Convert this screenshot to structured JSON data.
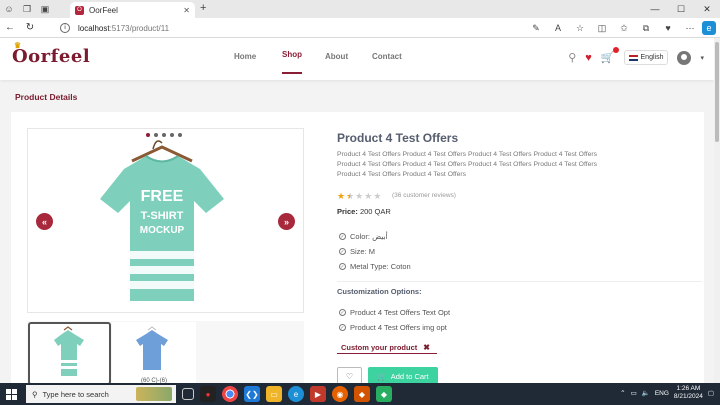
{
  "browser": {
    "tab_title": "OorFeel",
    "url_host": "localhost",
    "url_path": ":5173/product/11"
  },
  "site": {
    "logo": "Oorfeel",
    "menu": {
      "home": "Home",
      "shop": "Shop",
      "about": "About",
      "contact": "Contact"
    },
    "language": "English",
    "accent_color": "#8b1e36"
  },
  "page": {
    "title": "Product Details"
  },
  "product": {
    "name": "Product 4 Test Offers",
    "description": "Product 4 Test Offers Product 4 Test Offers Product 4 Test Offers Product 4 Test Offers Product 4 Test Offers Product 4 Test Offers Product 4 Test Offers Product 4 Test Offers Product 4 Test Offers Product 4 Test Offers",
    "rating": 1.5,
    "rating_max": 5,
    "reviews": "(36 customer reviews)",
    "price_label": "Price:",
    "price_value": "200 QAR",
    "image_text_1": "FREE",
    "image_text_2": "T-SHIRT",
    "image_text_3": "MOCKUP",
    "thumb2_caption": "(60 C)-(6)",
    "color": "Color: أبيض",
    "size": "Size: M",
    "metal": "Metal Type: Coton",
    "customization_title": "Customization Options:",
    "custom_opt_1": "Product 4 Test Offers Text Opt",
    "custom_opt_2": "Product 4 Test Offers img opt",
    "customize_button": "Custom your product",
    "add_to_cart": "Add to Cart",
    "active_slide": 1,
    "slide_count": 5
  },
  "taskbar": {
    "search_placeholder": "Type here to search",
    "time": "1:26 AM",
    "date": "8/21/2024",
    "lang": "ENG"
  }
}
